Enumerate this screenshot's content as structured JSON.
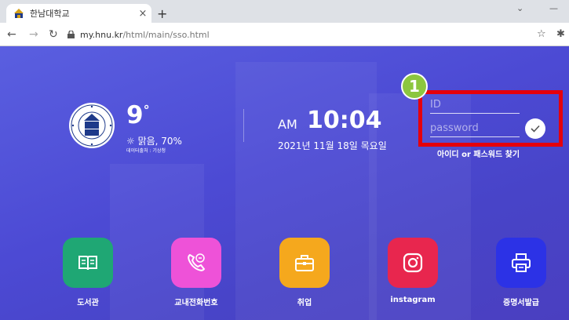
{
  "browser": {
    "tab_title": "한남대학교",
    "tab_close": "×",
    "new_tab": "+",
    "url_host": "my.hnu.kr",
    "url_path": "/html/main/sso.html"
  },
  "weather": {
    "temperature": "9",
    "degree": "°",
    "condition": "☼ 맑음, 70%",
    "source": "데이터출처 : 기상청"
  },
  "clock": {
    "ampm": "AM",
    "time": "10:04",
    "date": "2021년 11월 18일 목요일"
  },
  "login": {
    "id_placeholder": "ID",
    "password_placeholder": "password",
    "find_label": "아이디 or 패스워드 찾기",
    "step_number": "1",
    "highlight_color": "#e5000b",
    "step_color": "#8cc63f"
  },
  "apps": [
    {
      "label": "도서관",
      "icon": "book-icon",
      "color": "#1fa774"
    },
    {
      "label": "교내전화번호",
      "icon": "phone-icon",
      "color": "#ee52d8"
    },
    {
      "label": "취업",
      "icon": "briefcase-icon",
      "color": "#f5a81d"
    },
    {
      "label": "instagram",
      "icon": "instagram-icon",
      "color": "#e8264e"
    },
    {
      "label": "증명서발급",
      "icon": "printer-icon",
      "color": "#2c32e6"
    }
  ]
}
